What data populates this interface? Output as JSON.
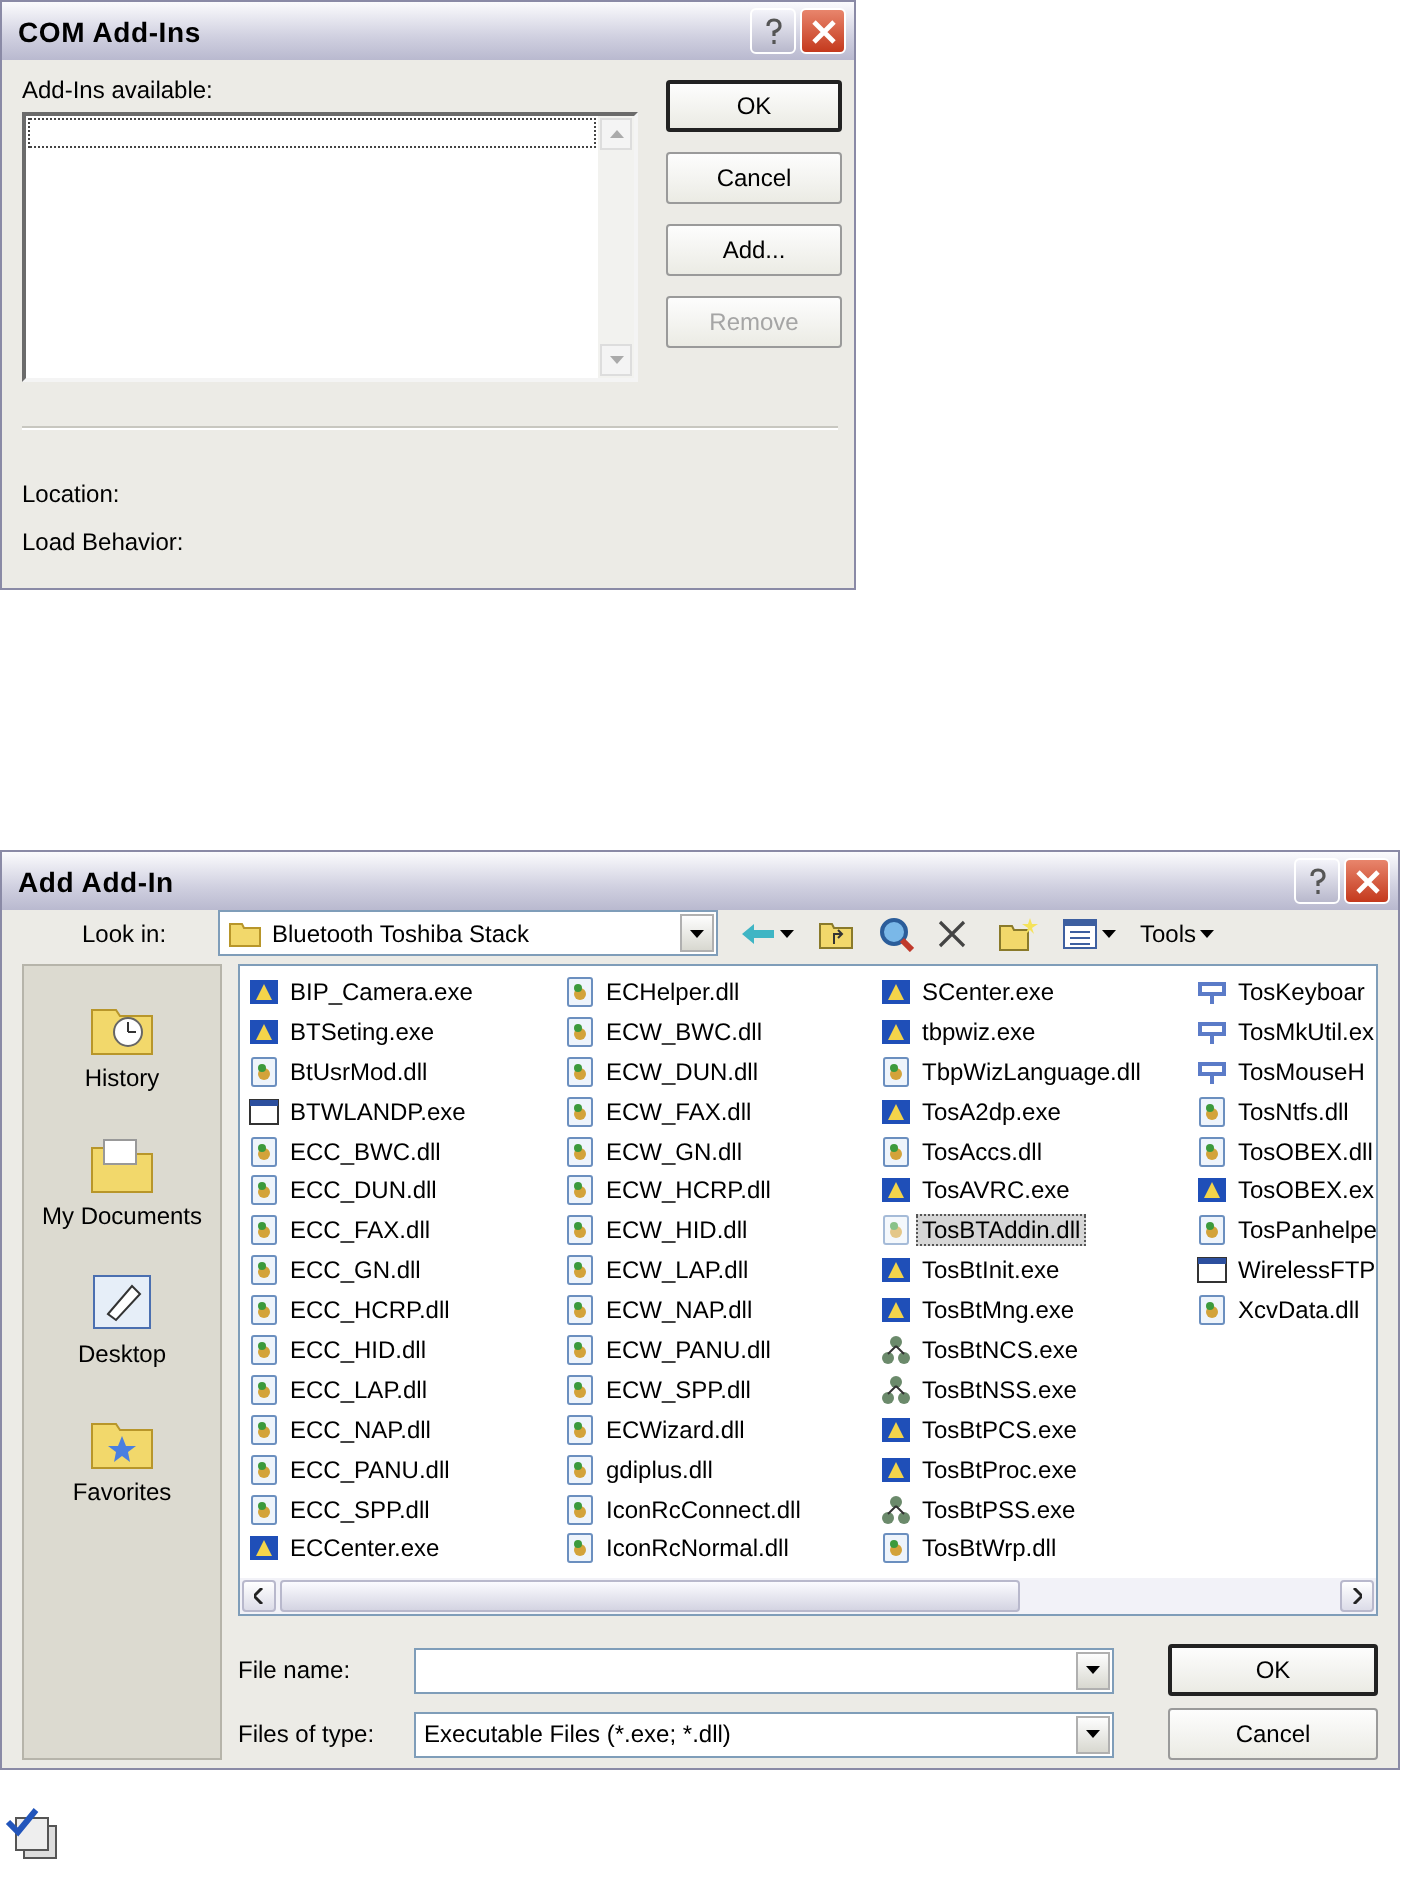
{
  "com_dialog": {
    "title": "COM Add-Ins",
    "list_label": "Add-Ins available:",
    "buttons": [
      {
        "label": "OK",
        "default": true,
        "disabled": false
      },
      {
        "label": "Cancel",
        "default": false,
        "disabled": false
      },
      {
        "label": "Add...",
        "default": false,
        "disabled": false
      },
      {
        "label": "Remove",
        "default": false,
        "disabled": true
      }
    ],
    "fields": [
      "Location:",
      "Load Behavior:"
    ]
  },
  "add_dialog": {
    "title": "Add Add-In",
    "look_in_label": "Look in:",
    "look_in_value": "Bluetooth Toshiba Stack",
    "tools_label": "Tools",
    "places": [
      {
        "label": "History",
        "kind": "history"
      },
      {
        "label": "My Documents",
        "kind": "documents"
      },
      {
        "label": "Desktop",
        "kind": "desktop"
      },
      {
        "label": "Favorites",
        "kind": "favorites"
      }
    ],
    "file_columns": [
      [
        {
          "name": "BIP_Camera.exe",
          "kind": "app",
          "selected": false
        },
        {
          "name": "BTSeting.exe",
          "kind": "app",
          "selected": false
        },
        {
          "name": "BtUsrMod.dll",
          "kind": "dll",
          "selected": false
        },
        {
          "name": "BTWLANDP.exe",
          "kind": "window",
          "selected": false
        },
        {
          "name": "ECC_BWC.dll",
          "kind": "dll",
          "selected": false
        },
        {
          "name": "ECC_DUN.dll",
          "kind": "dll",
          "selected": false
        },
        {
          "name": "ECC_FAX.dll",
          "kind": "dll",
          "selected": false
        },
        {
          "name": "ECC_GN.dll",
          "kind": "dll",
          "selected": false
        },
        {
          "name": "ECC_HCRP.dll",
          "kind": "dll",
          "selected": false
        },
        {
          "name": "ECC_HID.dll",
          "kind": "dll",
          "selected": false
        },
        {
          "name": "ECC_LAP.dll",
          "kind": "dll",
          "selected": false
        },
        {
          "name": "ECC_NAP.dll",
          "kind": "dll",
          "selected": false
        },
        {
          "name": "ECC_PANU.dll",
          "kind": "dll",
          "selected": false
        },
        {
          "name": "ECC_SPP.dll",
          "kind": "dll",
          "selected": false
        },
        {
          "name": "ECCenter.exe",
          "kind": "app",
          "selected": false
        }
      ],
      [
        {
          "name": "ECHelper.dll",
          "kind": "dll",
          "selected": false
        },
        {
          "name": "ECW_BWC.dll",
          "kind": "dll",
          "selected": false
        },
        {
          "name": "ECW_DUN.dll",
          "kind": "dll",
          "selected": false
        },
        {
          "name": "ECW_FAX.dll",
          "kind": "dll",
          "selected": false
        },
        {
          "name": "ECW_GN.dll",
          "kind": "dll",
          "selected": false
        },
        {
          "name": "ECW_HCRP.dll",
          "kind": "dll",
          "selected": false
        },
        {
          "name": "ECW_HID.dll",
          "kind": "dll",
          "selected": false
        },
        {
          "name": "ECW_LAP.dll",
          "kind": "dll",
          "selected": false
        },
        {
          "name": "ECW_NAP.dll",
          "kind": "dll",
          "selected": false
        },
        {
          "name": "ECW_PANU.dll",
          "kind": "dll",
          "selected": false
        },
        {
          "name": "ECW_SPP.dll",
          "kind": "dll",
          "selected": false
        },
        {
          "name": "ECWizard.dll",
          "kind": "dll",
          "selected": false
        },
        {
          "name": "gdiplus.dll",
          "kind": "dll",
          "selected": false
        },
        {
          "name": "IconRcConnect.dll",
          "kind": "dll",
          "selected": false
        },
        {
          "name": "IconRcNormal.dll",
          "kind": "dll",
          "selected": false
        }
      ],
      [
        {
          "name": "SCenter.exe",
          "kind": "app",
          "selected": false
        },
        {
          "name": "tbpwiz.exe",
          "kind": "app",
          "selected": false
        },
        {
          "name": "TbpWizLanguage.dll",
          "kind": "dll",
          "selected": false
        },
        {
          "name": "TosA2dp.exe",
          "kind": "app",
          "selected": false
        },
        {
          "name": "TosAccs.dll",
          "kind": "dll",
          "selected": false
        },
        {
          "name": "TosAVRC.exe",
          "kind": "app",
          "selected": false
        },
        {
          "name": "TosBTAddin.dll",
          "kind": "dll",
          "selected": true
        },
        {
          "name": "TosBtInit.exe",
          "kind": "app",
          "selected": false
        },
        {
          "name": "TosBtMng.exe",
          "kind": "app",
          "selected": false
        },
        {
          "name": "TosBtNCS.exe",
          "kind": "network",
          "selected": false
        },
        {
          "name": "TosBtNSS.exe",
          "kind": "network",
          "selected": false
        },
        {
          "name": "TosBtPCS.exe",
          "kind": "app",
          "selected": false
        },
        {
          "name": "TosBtProc.exe",
          "kind": "app",
          "selected": false
        },
        {
          "name": "TosBtPSS.exe",
          "kind": "network",
          "selected": false
        },
        {
          "name": "TosBtWrp.dll",
          "kind": "dll",
          "selected": false
        }
      ],
      [
        {
          "name": "TosKeyboar",
          "kind": "keyboard",
          "selected": false
        },
        {
          "name": "TosMkUtil.ex",
          "kind": "keyboard",
          "selected": false
        },
        {
          "name": "TosMouseH",
          "kind": "keyboard",
          "selected": false
        },
        {
          "name": "TosNtfs.dll",
          "kind": "dll",
          "selected": false
        },
        {
          "name": "TosOBEX.dll",
          "kind": "dll",
          "selected": false
        },
        {
          "name": "TosOBEX.ex",
          "kind": "app",
          "selected": false
        },
        {
          "name": "TosPanhelpe",
          "kind": "dll",
          "selected": false
        },
        {
          "name": "WirelessFTP",
          "kind": "window",
          "selected": false
        },
        {
          "name": "XcvData.dll",
          "kind": "dll",
          "selected": false
        }
      ]
    ],
    "file_name_label": "File name:",
    "file_type_label": "Files of type:",
    "file_type_value": "Executable Files (*.exe; *.dll)",
    "buttons": [
      {
        "label": "OK",
        "default": true
      },
      {
        "label": "Cancel",
        "default": false
      }
    ]
  }
}
